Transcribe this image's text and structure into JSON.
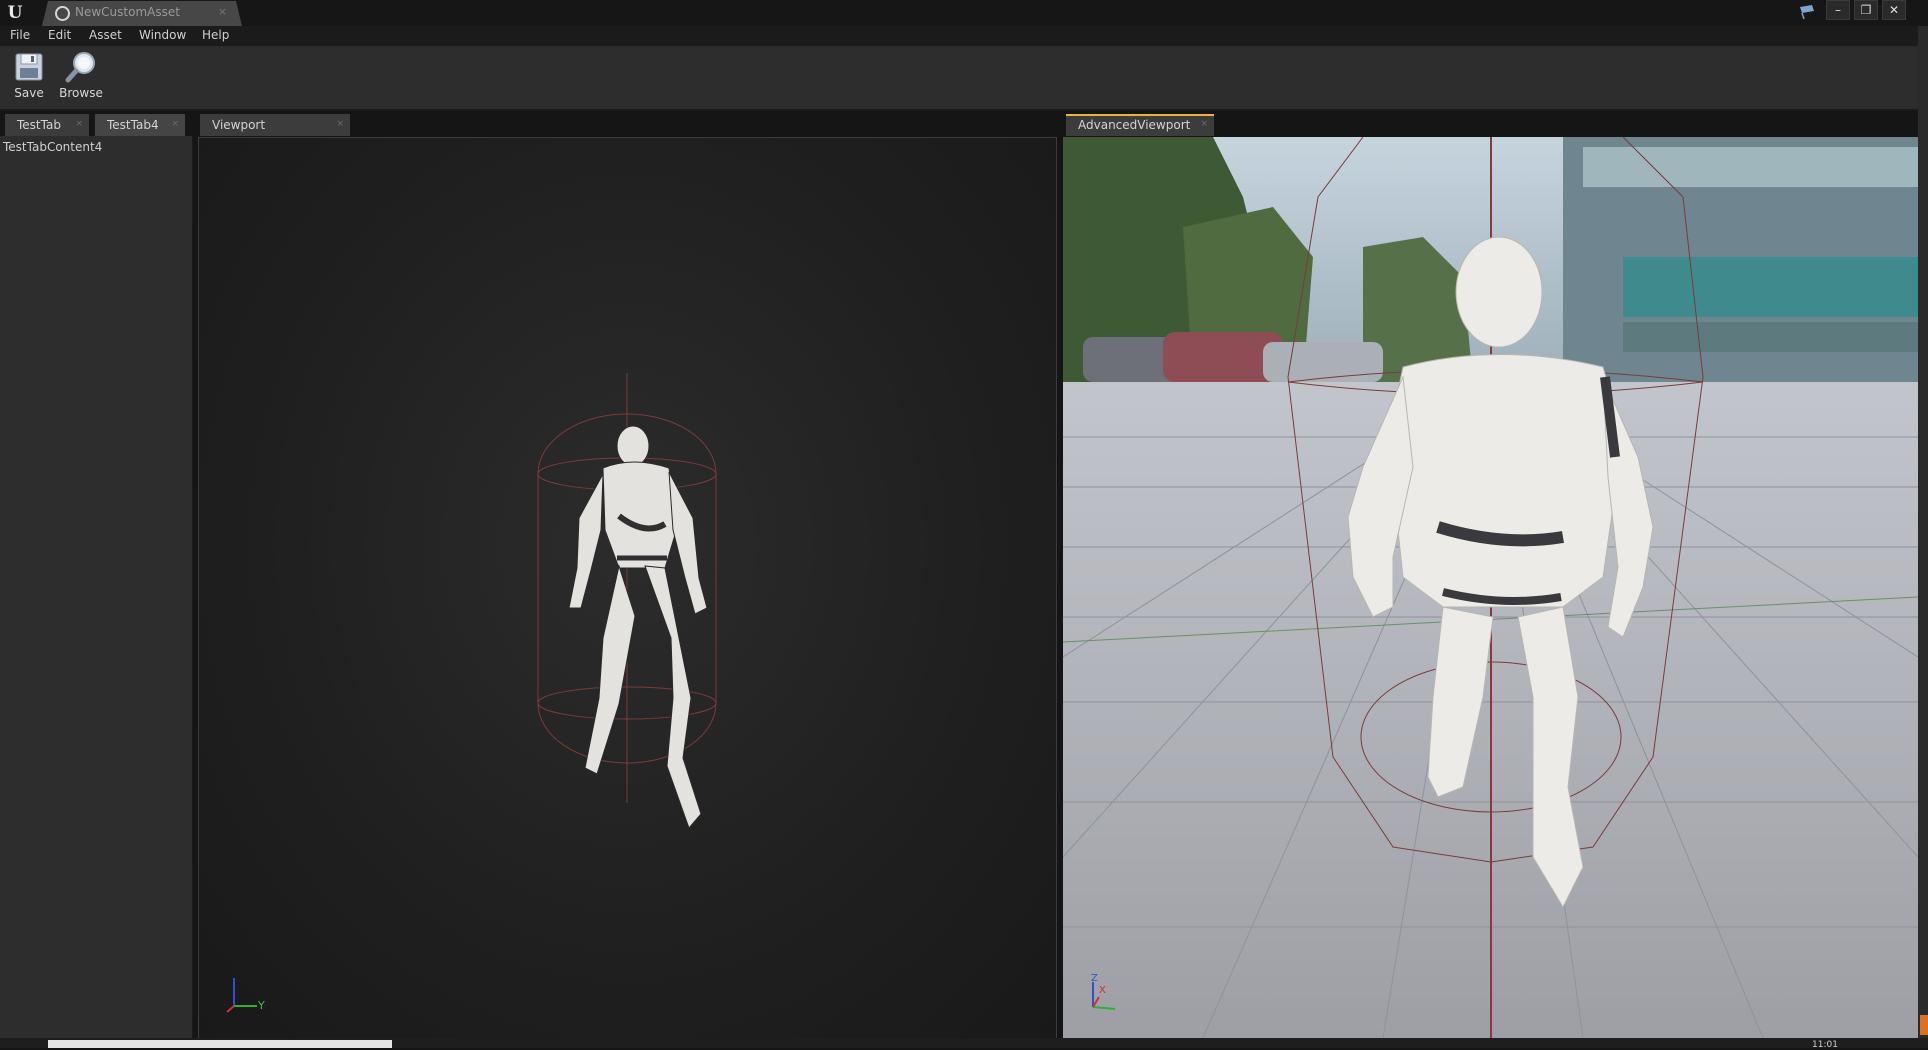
{
  "window": {
    "app_icon": "unreal-logo-icon",
    "asset_tab": {
      "label": "NewCustomAsset",
      "close": "×"
    },
    "feedback_icon": "feedback-flag-icon",
    "controls": {
      "minimize": "–",
      "restore": "❐",
      "close": "✕"
    }
  },
  "menu": {
    "items": [
      "File",
      "Edit",
      "Asset",
      "Window",
      "Help"
    ]
  },
  "toolbar": {
    "save_label": "Save",
    "browse_label": "Browse"
  },
  "tabs": {
    "left": [
      {
        "label": "TestTab",
        "close": "×"
      },
      {
        "label": "TestTab4",
        "close": "×"
      }
    ],
    "viewport": {
      "label": "Viewport",
      "close": "×"
    },
    "advanced": {
      "label": "AdvancedViewport",
      "close": "×"
    }
  },
  "left_panel": {
    "content": "TestTabContent4"
  },
  "viewport": {
    "axis_y_label": "Y"
  },
  "advanced_viewport": {
    "axis_z_label": "Z",
    "axis_x_label": "X"
  },
  "status": {
    "time": "11:01"
  },
  "colors": {
    "accent": "#f0b030",
    "capsule": "#7a3b3b"
  }
}
